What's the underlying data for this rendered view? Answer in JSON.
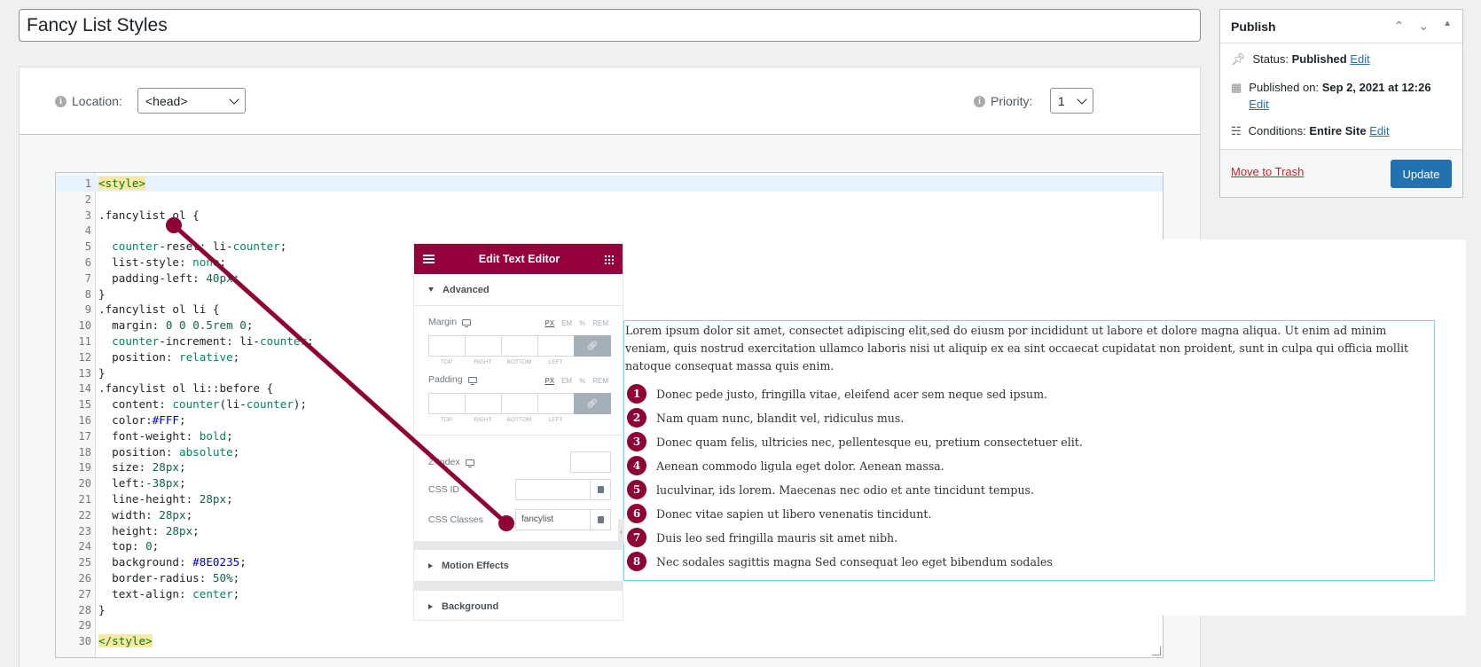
{
  "title": "Fancy List Styles",
  "location": {
    "label": "Location:",
    "value": "<head>"
  },
  "priority": {
    "label": "Priority:",
    "value": "1"
  },
  "code": [
    {
      "n": "1",
      "t": "<style>"
    },
    {
      "n": "2",
      "t": ""
    },
    {
      "n": "3",
      "t": ".fancylist ol {"
    },
    {
      "n": "4",
      "t": ""
    },
    {
      "n": "5",
      "t": "  counter-reset: li-counter;"
    },
    {
      "n": "6",
      "t": "  list-style: none;"
    },
    {
      "n": "7",
      "t": "  padding-left: 40px;"
    },
    {
      "n": "8",
      "t": "}"
    },
    {
      "n": "9",
      "t": ".fancylist ol li {"
    },
    {
      "n": "10",
      "t": "  margin: 0 0 0.5rem 0;"
    },
    {
      "n": "11",
      "t": "  counter-increment: li-counter;"
    },
    {
      "n": "12",
      "t": "  position: relative;"
    },
    {
      "n": "13",
      "t": "}"
    },
    {
      "n": "14",
      "t": ".fancylist ol li::before {"
    },
    {
      "n": "15",
      "t": "  content: counter(li-counter);"
    },
    {
      "n": "16",
      "t": "  color:#FFF;"
    },
    {
      "n": "17",
      "t": "  font-weight: bold;"
    },
    {
      "n": "18",
      "t": "  position: absolute;"
    },
    {
      "n": "19",
      "t": "  size: 28px;"
    },
    {
      "n": "20",
      "t": "  left:-38px;"
    },
    {
      "n": "21",
      "t": "  line-height: 28px;"
    },
    {
      "n": "22",
      "t": "  width: 28px;"
    },
    {
      "n": "23",
      "t": "  height: 28px;"
    },
    {
      "n": "24",
      "t": "  top: 0;"
    },
    {
      "n": "25",
      "t": "  background: #8E0235;"
    },
    {
      "n": "26",
      "t": "  border-radius: 50%;"
    },
    {
      "n": "27",
      "t": "  text-align: center;"
    },
    {
      "n": "28",
      "t": "}"
    },
    {
      "n": "29",
      "t": ""
    },
    {
      "n": "30",
      "t": "</style>"
    }
  ],
  "publish": {
    "title": "Publish",
    "status_label": "Status: ",
    "status_value": "Published",
    "published_label": "Published on: ",
    "published_value": "Sep 2, 2021 at 12:26",
    "conditions_label": "Conditions: ",
    "conditions_value": "Entire Site",
    "edit": "Edit",
    "trash": "Move to Trash",
    "update": "Update"
  },
  "elementor": {
    "title": "Edit Text Editor",
    "section_advanced": "Advanced",
    "margin": "Margin",
    "padding": "Padding",
    "units": [
      "PX",
      "EM",
      "%",
      "REM"
    ],
    "dims": [
      "TOP",
      "RIGHT",
      "BOTTOM",
      "LEFT"
    ],
    "zindex": "Z-Index",
    "css_id": "CSS ID",
    "css_classes": "CSS Classes",
    "css_classes_value": "fancylist",
    "motion": "Motion Effects",
    "background": "Background"
  },
  "preview": {
    "lorem": "Lorem ipsum dolor sit amet, consectet adipiscing elit,sed do eiusm por incididunt ut labore et dolore magna aliqua. Ut enim ad minim veniam, quis nostrud exercitation ullamco laboris nisi ut aliquip ex ea sint occaecat cupidatat non proident, sunt in culpa qui officia mollit natoque consequat massa quis enim.",
    "items": [
      {
        "num": "1",
        "text": "Donec pede justo, fringilla vitae, eleifend acer sem neque sed ipsum."
      },
      {
        "num": "2",
        "text": "Nam quam nunc, blandit vel, ridiculus mus."
      },
      {
        "num": "3",
        "text": "Donec quam felis, ultricies nec, pellentesque eu, pretium consectetuer elit."
      },
      {
        "num": "4",
        "text": "Aenean commodo ligula eget dolor. Aenean massa."
      },
      {
        "num": "5",
        "text": "luculvinar, ids lorem. Maecenas nec odio et ante tincidunt tempus."
      },
      {
        "num": "6",
        "text": "Donec vitae sapien ut libero venenatis tincidunt."
      },
      {
        "num": "7",
        "text": "Duis leo sed fringilla mauris sit amet nibh."
      },
      {
        "num": "8",
        "text": "Nec sodales sagittis magna Sed consequat leo eget bibendum sodales"
      }
    ]
  },
  "colors": {
    "accent": "#93003c",
    "list_bullet": "#8E0235",
    "wp_blue": "#2271b1",
    "connector": "#8e0235"
  }
}
